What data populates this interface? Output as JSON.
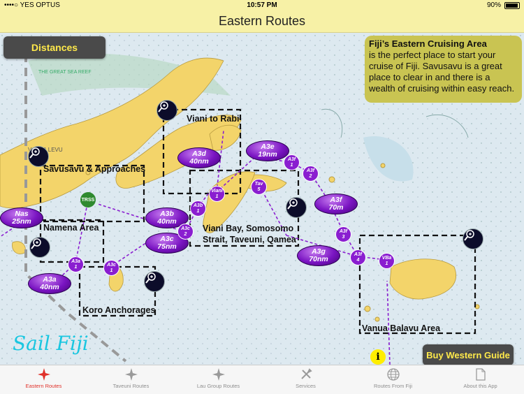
{
  "status_bar": {
    "carrier": "••••○ YES OPTUS",
    "time": "10:57 PM",
    "battery": "90%"
  },
  "nav": {
    "title": "Eastern Routes"
  },
  "map": {
    "distances_button": "Distances",
    "info": {
      "heading": "Fiji’s  Eastern Cruising Area",
      "body": "is the perfect place to start your cruise of Fiji. Savusavu is a great place to clear in and there is a wealth of cruising within easy reach."
    },
    "chart_labels": {
      "great_sea_reef": "THE GREAT SEA REEF",
      "vanua_levu": "VANUA LEVU"
    },
    "zones": {
      "viani_to_rabi": "Viani to Rabi",
      "savusavu": "Savusavu & Approaches",
      "namena": "Namena Area",
      "viani_bay": "Viani Bay, Somosomo Strait, Taveuni, Qamea",
      "koro": "Koro Anchorages",
      "vanua_balavu": "Vanua Balavu Area"
    },
    "routes": [
      {
        "code": "Nas",
        "dist": "25nm"
      },
      {
        "code": "A3a",
        "dist": "40nm"
      },
      {
        "code": "A3b",
        "dist": "40nm"
      },
      {
        "code": "A3c",
        "dist": "75nm"
      },
      {
        "code": "A3d",
        "dist": "40nm"
      },
      {
        "code": "A3e",
        "dist": "19nm"
      },
      {
        "code": "A3f",
        "dist": "70m"
      },
      {
        "code": "A3g",
        "dist": "70nm"
      }
    ],
    "waypoints": [
      {
        "code": "A3a",
        "num": "1"
      },
      {
        "code": "A3c",
        "num": "1"
      },
      {
        "code": "A3c",
        "num": "2"
      },
      {
        "code": "A3b",
        "num": "1"
      },
      {
        "code": "Viani",
        "num": "1"
      },
      {
        "code": "Tav",
        "num": "5"
      },
      {
        "code": "A3f",
        "num": "1"
      },
      {
        "code": "A3f",
        "num": "2"
      },
      {
        "code": "A3f",
        "num": "3"
      },
      {
        "code": "A3f",
        "num": "4"
      },
      {
        "code": "VBa",
        "num": "1"
      }
    ],
    "trss_label": "TRSS",
    "logo": "Sail Fiji",
    "info_icon": "i",
    "western_button": "Buy Western Guide"
  },
  "tabs": [
    {
      "label": "Eastern Routes",
      "icon": "compass-rose-icon",
      "active": true
    },
    {
      "label": "Taveuni Routes",
      "icon": "compass-rose-icon",
      "active": false
    },
    {
      "label": "Lau Group Routes",
      "icon": "compass-rose-icon",
      "active": false
    },
    {
      "label": "Services",
      "icon": "tools-icon",
      "active": false
    },
    {
      "label": "Routes From Fiji",
      "icon": "globe-icon",
      "active": false
    },
    {
      "label": "About this App",
      "icon": "document-icon",
      "active": false
    }
  ],
  "colors": {
    "bar": "#f7f1a6",
    "accent": "#e0312a",
    "route": "#8a1ed0",
    "land": "#f3d46a",
    "sea": "#dde9f0"
  }
}
